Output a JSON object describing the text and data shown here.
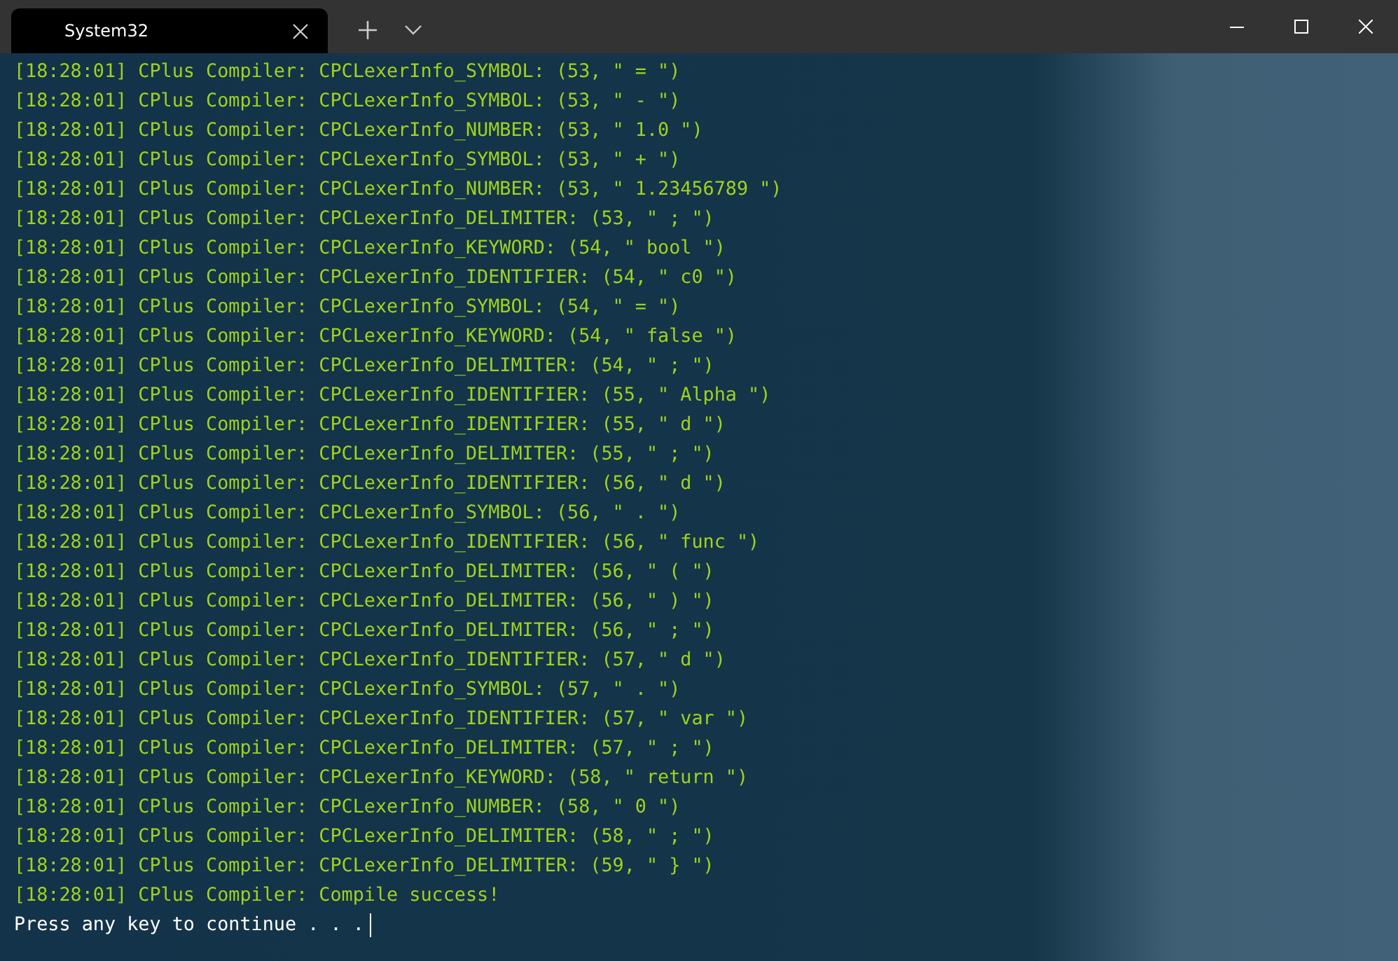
{
  "window": {
    "tab_title": "System32"
  },
  "log_lines": [
    "[18:28:01] CPlus Compiler: CPCLexerInfo_SYMBOL: (53, \" = \")",
    "[18:28:01] CPlus Compiler: CPCLexerInfo_SYMBOL: (53, \" - \")",
    "[18:28:01] CPlus Compiler: CPCLexerInfo_NUMBER: (53, \" 1.0 \")",
    "[18:28:01] CPlus Compiler: CPCLexerInfo_SYMBOL: (53, \" + \")",
    "[18:28:01] CPlus Compiler: CPCLexerInfo_NUMBER: (53, \" 1.23456789 \")",
    "[18:28:01] CPlus Compiler: CPCLexerInfo_DELIMITER: (53, \" ; \")",
    "[18:28:01] CPlus Compiler: CPCLexerInfo_KEYWORD: (54, \" bool \")",
    "[18:28:01] CPlus Compiler: CPCLexerInfo_IDENTIFIER: (54, \" c0 \")",
    "[18:28:01] CPlus Compiler: CPCLexerInfo_SYMBOL: (54, \" = \")",
    "[18:28:01] CPlus Compiler: CPCLexerInfo_KEYWORD: (54, \" false \")",
    "[18:28:01] CPlus Compiler: CPCLexerInfo_DELIMITER: (54, \" ; \")",
    "[18:28:01] CPlus Compiler: CPCLexerInfo_IDENTIFIER: (55, \" Alpha \")",
    "[18:28:01] CPlus Compiler: CPCLexerInfo_IDENTIFIER: (55, \" d \")",
    "[18:28:01] CPlus Compiler: CPCLexerInfo_DELIMITER: (55, \" ; \")",
    "[18:28:01] CPlus Compiler: CPCLexerInfo_IDENTIFIER: (56, \" d \")",
    "[18:28:01] CPlus Compiler: CPCLexerInfo_SYMBOL: (56, \" . \")",
    "[18:28:01] CPlus Compiler: CPCLexerInfo_IDENTIFIER: (56, \" func \")",
    "[18:28:01] CPlus Compiler: CPCLexerInfo_DELIMITER: (56, \" ( \")",
    "[18:28:01] CPlus Compiler: CPCLexerInfo_DELIMITER: (56, \" ) \")",
    "[18:28:01] CPlus Compiler: CPCLexerInfo_DELIMITER: (56, \" ; \")",
    "[18:28:01] CPlus Compiler: CPCLexerInfo_IDENTIFIER: (57, \" d \")",
    "[18:28:01] CPlus Compiler: CPCLexerInfo_SYMBOL: (57, \" . \")",
    "[18:28:01] CPlus Compiler: CPCLexerInfo_IDENTIFIER: (57, \" var \")",
    "[18:28:01] CPlus Compiler: CPCLexerInfo_DELIMITER: (57, \" ; \")",
    "[18:28:01] CPlus Compiler: CPCLexerInfo_KEYWORD: (58, \" return \")",
    "[18:28:01] CPlus Compiler: CPCLexerInfo_NUMBER: (58, \" 0 \")",
    "[18:28:01] CPlus Compiler: CPCLexerInfo_DELIMITER: (58, \" ; \")",
    "[18:28:01] CPlus Compiler: CPCLexerInfo_DELIMITER: (59, \" } \")",
    "[18:28:01] CPlus Compiler: Compile success!"
  ],
  "prompt": "Press any key to continue . . ."
}
